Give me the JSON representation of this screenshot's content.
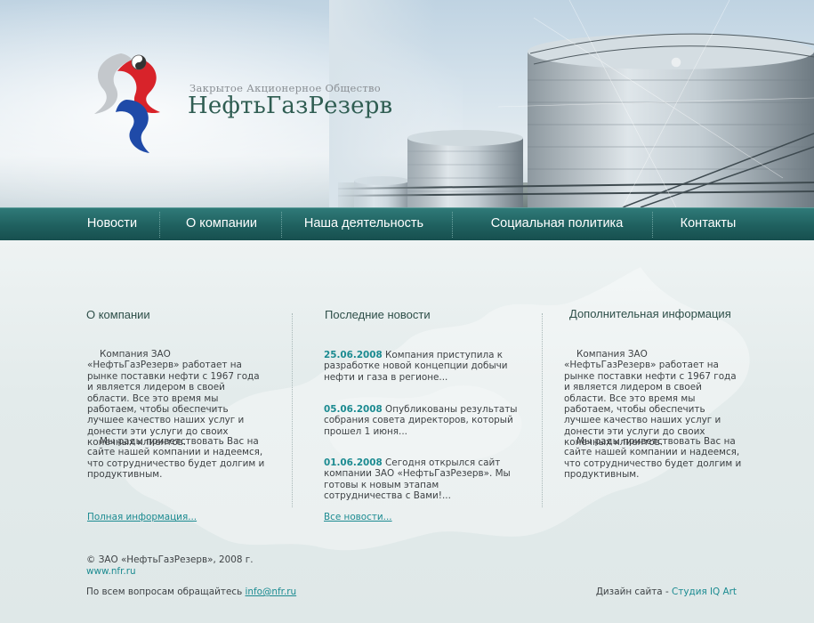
{
  "header": {
    "company_sub": "Закрытое Акционерное Общество",
    "company_name": "НефтьГазРезерв"
  },
  "nav": {
    "items": [
      {
        "label": "Новости"
      },
      {
        "label": "О компании"
      },
      {
        "label": "Наша деятельность"
      },
      {
        "label": "Социальная политика"
      },
      {
        "label": "Контакты"
      }
    ]
  },
  "about": {
    "title": "О компании",
    "p1": "Компания ЗАО «НефтьГазРезерв» работает на рынке поставки нефти с 1967 года и является лидером в своей области. Все это время мы работаем, чтобы обеспечить лучшее качество наших услуг и донести эти услуги до своих конечных клиентов.",
    "p2": "Мы рады приветствовать Вас на сайте нашей компании и надеемся, что сотрудничество будет долгим и продуктивным.",
    "more_link": "Полная информация..."
  },
  "news": {
    "title": "Последние новости",
    "items": [
      {
        "date": "25.06.2008",
        "text": "Компания приступила к разработке новой концепции добычи нефти и газа в регионе..."
      },
      {
        "date": "05.06.2008",
        "text": "Опубликованы результаты собрания совета директоров, который прошел 1 июня..."
      },
      {
        "date": "01.06.2008",
        "text": "Сегодня открылся сайт компании ЗАО «НефтьГазРезерв». Мы готовы к новым этапам сотрудничества с Вами!..."
      }
    ],
    "all_link": "Все новости..."
  },
  "extra": {
    "title": "Дополнительная информация",
    "p1": "Компания ЗАО «НефтьГазРезерв» работает на рынке поставки нефти с 1967 года и является лидером в своей области. Все это время мы работаем, чтобы обеспечить лучшее качество наших услуг и донести эти услуги до своих конечных клиентов.",
    "p2": "Мы рады приветствовать Вас на сайте нашей компании и надеемся, что сотрудничество будет долгим и продуктивным."
  },
  "footer": {
    "copyright": "© ЗАО «НефтьГазРезерв», 2008 г.",
    "site": "www.nfr.ru",
    "contact_prefix": "По всем вопросам обращайтесь",
    "email": "info@nfr.ru",
    "design_prefix": "Дизайн сайта -",
    "design_studio": "Студия IQ Art"
  },
  "colors": {
    "accent": "#1c8b91",
    "nav": "#1f605f",
    "title": "#2e4f49",
    "logo_red": "#d8232a",
    "logo_blue": "#1f4aa8"
  }
}
